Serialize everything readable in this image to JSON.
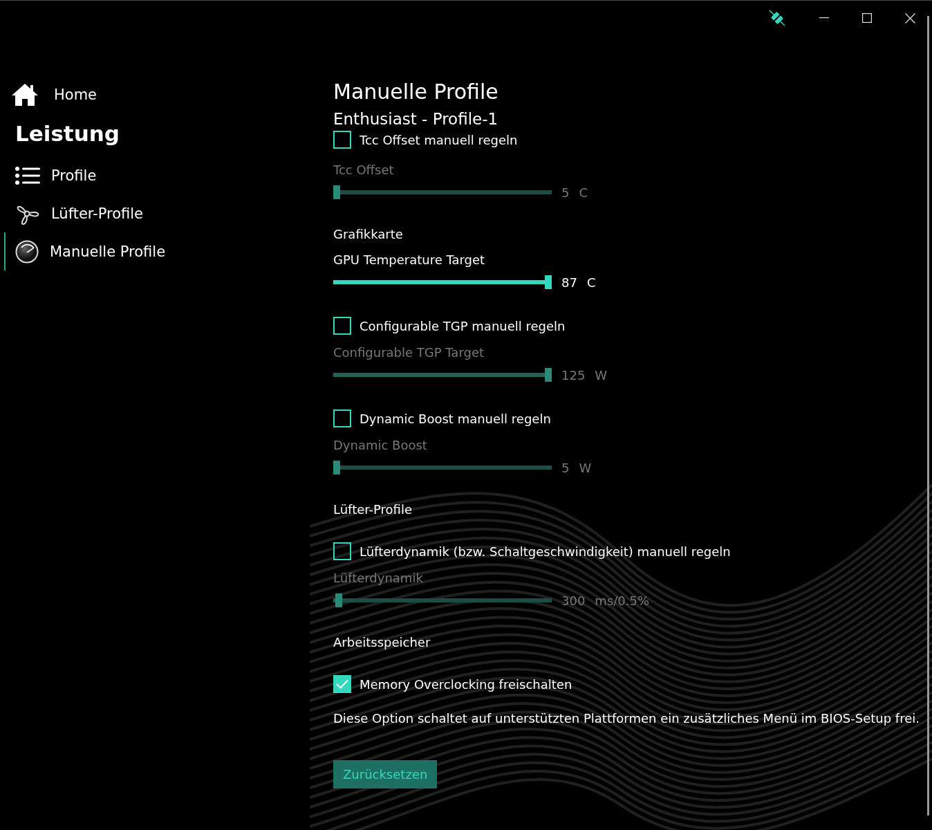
{
  "nav": {
    "home": "Home",
    "section": "Leistung",
    "items": [
      {
        "label": "Profile",
        "selected": false
      },
      {
        "label": "Lüfter-Profile",
        "selected": false
      },
      {
        "label": "Manuelle Profile",
        "selected": true
      }
    ]
  },
  "page": {
    "title": "Manuelle Profile",
    "subtitle": "Enthusiast - Profile-1"
  },
  "controls": [
    {
      "kind": "checkbox",
      "label": "Tcc Offset manuell regeln",
      "checked": false
    },
    {
      "kind": "slider",
      "label": "Tcc Offset",
      "level": 0.0,
      "disabled": true,
      "value": "5",
      "unit": "C"
    },
    {
      "kind": "heading",
      "label": "Grafikkarte"
    },
    {
      "kind": "slider",
      "label": "GPU Temperature Target",
      "level": 1.0,
      "disabled": false,
      "value": "87",
      "unit": "C"
    },
    {
      "kind": "checkbox",
      "label": "Configurable TGP manuell regeln",
      "checked": false
    },
    {
      "kind": "slider",
      "label": "Configurable TGP Target",
      "level": 1.0,
      "disabled": true,
      "value": "125",
      "unit": "W"
    },
    {
      "kind": "checkbox",
      "label": "Dynamic Boost manuell regeln",
      "checked": false
    },
    {
      "kind": "slider",
      "label": "Dynamic Boost",
      "level": 0.0,
      "disabled": true,
      "value": "5",
      "unit": "W"
    },
    {
      "kind": "heading",
      "label": "Lüfter-Profile"
    },
    {
      "kind": "checkbox",
      "label": "Lüfterdynamik (bzw. Schaltgeschwindigkeit) manuell regeln",
      "checked": false
    },
    {
      "kind": "slider",
      "label": "Lüfterdynamik",
      "level": 0.01,
      "disabled": true,
      "value": "300",
      "unit": "ms/0.5%"
    },
    {
      "kind": "heading",
      "label": "Arbeitsspeicher"
    },
    {
      "kind": "checkbox",
      "label": "Memory Overclocking freischalten",
      "checked": true
    },
    {
      "kind": "note",
      "label": "Diese Option schaltet auf unterstützten Plattformen ein zusätzliches Menü im BIOS-Setup frei."
    }
  ],
  "reset_button": "Zurücksetzen"
}
